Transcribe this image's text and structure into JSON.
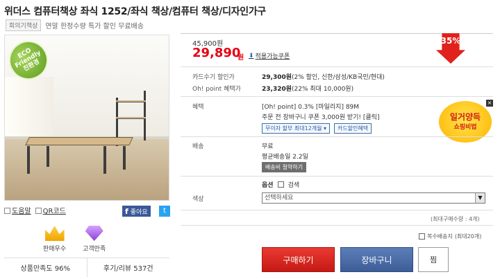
{
  "product": {
    "title": "위더스 컴퓨터책상 좌식 1252/좌식 책상/컴퓨터 책상/디자인가구",
    "category_tag": "회의기책상",
    "subtitle": "연말 한정수량 특가 할인 무료배송",
    "eco_badge": "ECO Friendly 친환경"
  },
  "util": {
    "help": "도움말",
    "qr": "QR코드",
    "like": "좋아요",
    "twitter": "t"
  },
  "badges": {
    "best_seller": "판매우수",
    "customer_choice": "고객만족"
  },
  "stats": {
    "satisfaction": "상품만족도 96%",
    "reviews": "후기/리뷰 537건"
  },
  "pricing": {
    "original_price": "45,900원",
    "sale_price": "29,890",
    "won": "원",
    "coupon_label": "적용가능쿠폰",
    "discount_percent": "35%"
  },
  "rows": {
    "card_label": "카드수기 할인가",
    "card_price": "29,300원",
    "card_note": "(2% 할인, 신한/삼성/KB국민/현대)",
    "oh_label": "Oh! point 혜택가",
    "oh_price": "23,320원",
    "oh_note": "(22% 최대 10,000원)",
    "benefit_label": "혜택",
    "benefit_line1": "[Oh! point] 0.3% [마일리지] 89M",
    "benefit_line2": "주문 전 장바구니 쿠폰 3,000원 받기! [클릭]",
    "benefit_btn1": "무이자 할부 최대12개월 ▾",
    "benefit_btn2": "카드할인혜택",
    "shipping_label": "배송",
    "shipping_value": "무료",
    "shipping_note": "평균배송일 2.2일",
    "shipping_btn": "배송비 절약하기",
    "color_label": "색상"
  },
  "promo": {
    "line1": "일거양득",
    "line2": "쇼핑비법",
    "close": "×"
  },
  "options": {
    "label": "옵션",
    "search_label": "검색",
    "select_value": "선택하세요",
    "max_buy": "(최대구매수량 : 4개)",
    "dup_label": "복수배송지",
    "dup_note": "(최대20개)"
  },
  "actions": {
    "buy": "구매하기",
    "cart": "장바구니",
    "wish": "찜"
  }
}
